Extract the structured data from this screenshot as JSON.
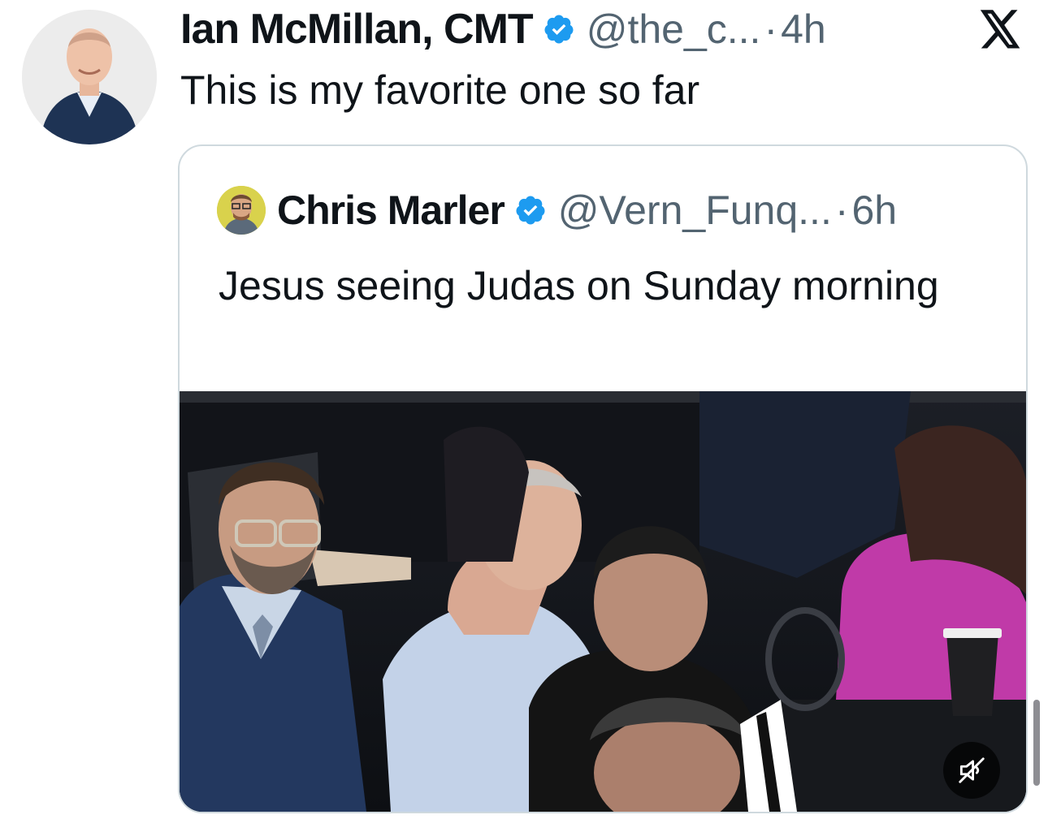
{
  "tweet": {
    "author": {
      "display_name": "Ian McMillan, CMT",
      "handle": "@the_c...",
      "verified": true,
      "avatar": "person-avatar"
    },
    "separator": "·",
    "time": "4h",
    "text": "This is my favorite one so far",
    "platform_logo": "x-logo-icon"
  },
  "quoted_tweet": {
    "author": {
      "display_name": "Chris Marler",
      "handle": "@Vern_Funq...",
      "verified": true,
      "avatar": "person-avatar"
    },
    "separator": "·",
    "time": "6h",
    "text": "Jesus seeing Judas on Sunday morning",
    "media": {
      "type": "video",
      "muted": true,
      "control_icon": "speaker-muted-icon"
    }
  },
  "colors": {
    "verified_blue": "#1d9bf0",
    "secondary_text": "#536471",
    "card_border": "#cfd9de",
    "primary_text": "#0f1419"
  }
}
